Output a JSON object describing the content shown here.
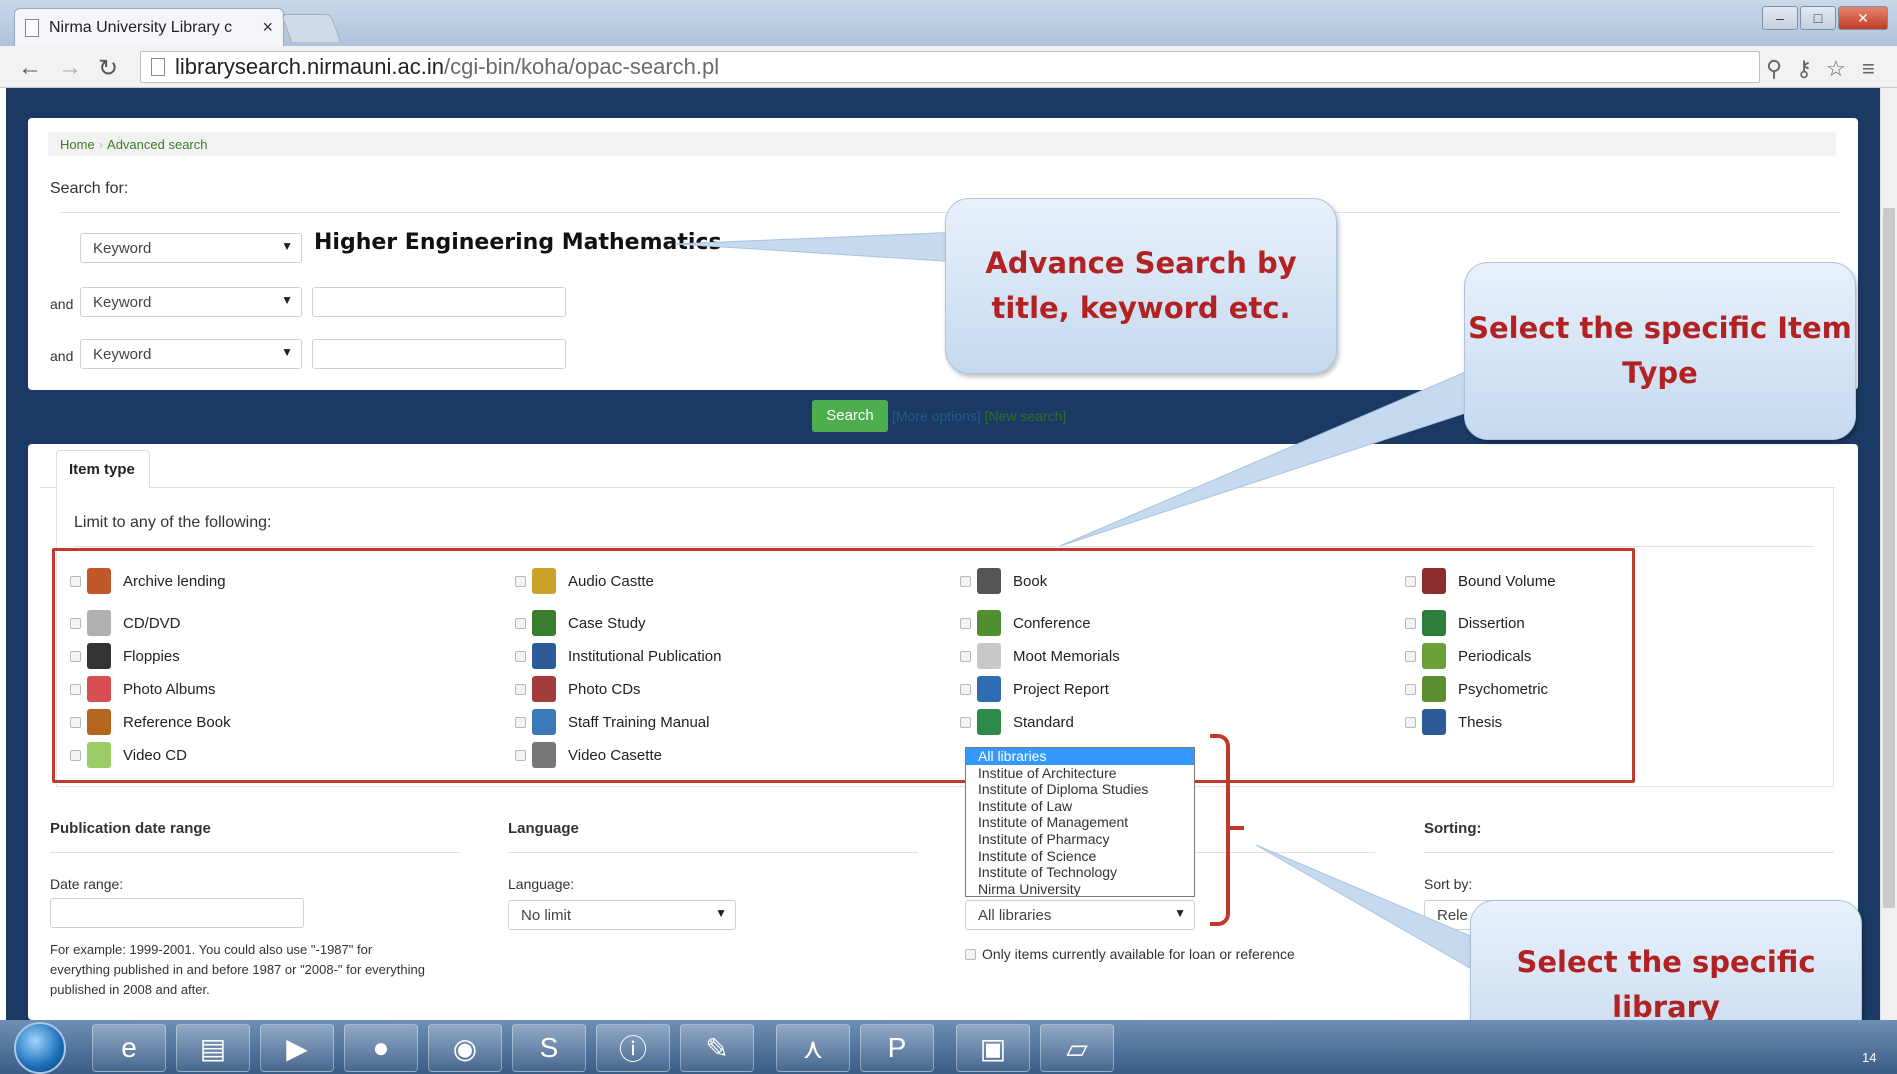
{
  "browser": {
    "tab_title": "Nirma University Library c",
    "tab_close": "×",
    "url_host": "librarysearch.nirmauni.ac.in",
    "url_path": "/cgi-bin/koha/opac-search.pl"
  },
  "breadcrumb": {
    "home": "Home",
    "current": "Advanced search"
  },
  "search": {
    "heading": "Search for:",
    "rows": [
      {
        "conjunction": "",
        "index": "Keyword",
        "term": "Higher Engineering Mathematics"
      },
      {
        "conjunction": "and",
        "index": "Keyword",
        "term": ""
      },
      {
        "conjunction": "and",
        "index": "Keyword",
        "term": ""
      }
    ],
    "search_button": "Search",
    "more_options": "[More options]",
    "new_search": "[New search]"
  },
  "item_type": {
    "tab_label": "Item type",
    "limit_heading": "Limit to any of the following:",
    "items": [
      {
        "label": "Archive lending",
        "icon": "archive-icon",
        "color": "#c2572b"
      },
      {
        "label": "Audio Castte",
        "icon": "audio-icon",
        "color": "#c9a227"
      },
      {
        "label": "Book",
        "icon": "book-icon",
        "color": "#555555"
      },
      {
        "label": "Bound Volume",
        "icon": "bound-volume-icon",
        "color": "#8b2d2d"
      },
      {
        "label": "CD/DVD",
        "icon": "cd-icon",
        "color": "#b0b0b0"
      },
      {
        "label": "Case Study",
        "icon": "case-study-icon",
        "color": "#3a7d2e"
      },
      {
        "label": "Conference",
        "icon": "conference-icon",
        "color": "#4f8f2f"
      },
      {
        "label": "Dissertion",
        "icon": "dissertation-icon",
        "color": "#2f7d3a"
      },
      {
        "label": "Floppies",
        "icon": "floppy-icon",
        "color": "#333333"
      },
      {
        "label": "Institutional Publication",
        "icon": "publication-icon",
        "color": "#2d5b9a"
      },
      {
        "label": "Moot Memorials",
        "icon": "memorial-icon",
        "color": "#c8c8c8"
      },
      {
        "label": "Periodicals",
        "icon": "periodical-icon",
        "color": "#6aa03a"
      },
      {
        "label": "Photo Albums",
        "icon": "photo-album-icon",
        "color": "#d94f4f"
      },
      {
        "label": "Photo CDs",
        "icon": "photo-cd-icon",
        "color": "#a33b3b"
      },
      {
        "label": "Project Report",
        "icon": "project-report-icon",
        "color": "#2f6db3"
      },
      {
        "label": "Psychometric",
        "icon": "psychometric-icon",
        "color": "#5a8f2f"
      },
      {
        "label": "Reference Book",
        "icon": "reference-book-icon",
        "color": "#b5651d"
      },
      {
        "label": "Staff Training Manual",
        "icon": "manual-icon",
        "color": "#3d7ab8"
      },
      {
        "label": "Standard",
        "icon": "standard-icon",
        "color": "#2f8a4a"
      },
      {
        "label": "Thesis",
        "icon": "thesis-icon",
        "color": "#2d5b9a"
      },
      {
        "label": "Video CD",
        "icon": "video-cd-icon",
        "color": "#9ccc65"
      },
      {
        "label": "Video Casette",
        "icon": "video-cassette-icon",
        "color": "#777777"
      }
    ]
  },
  "filters": {
    "pub_date_heading": "Publication date range",
    "date_range_label": "Date range:",
    "date_range_value": "",
    "date_help": "For example: 1999-2001. You could also use \"-1987\" for everything published in and before 1987 or \"2008-\" for everything published in 2008 and after.",
    "language_heading": "Language",
    "language_label": "Language:",
    "language_value": "No limit",
    "library_options": [
      "All libraries",
      "Institue of Architecture",
      "Institute of Diploma Studies",
      "Institute of Law",
      "Institute of Management",
      "Institute of Pharmacy",
      "Institute of Science",
      "Institute of Technology",
      "Nirma University"
    ],
    "library_value": "All libraries",
    "available_only_label": "Only items currently available for loan or reference",
    "sorting_heading": "Sorting:",
    "sort_by_label": "Sort by:",
    "sort_by_value": "Rele"
  },
  "callouts": {
    "advance_search": "Advance Search by title, keyword etc.",
    "item_type": "Select the specific Item Type",
    "library": "Select the specific library"
  },
  "taskbar": {
    "clock_fragment": "14"
  }
}
